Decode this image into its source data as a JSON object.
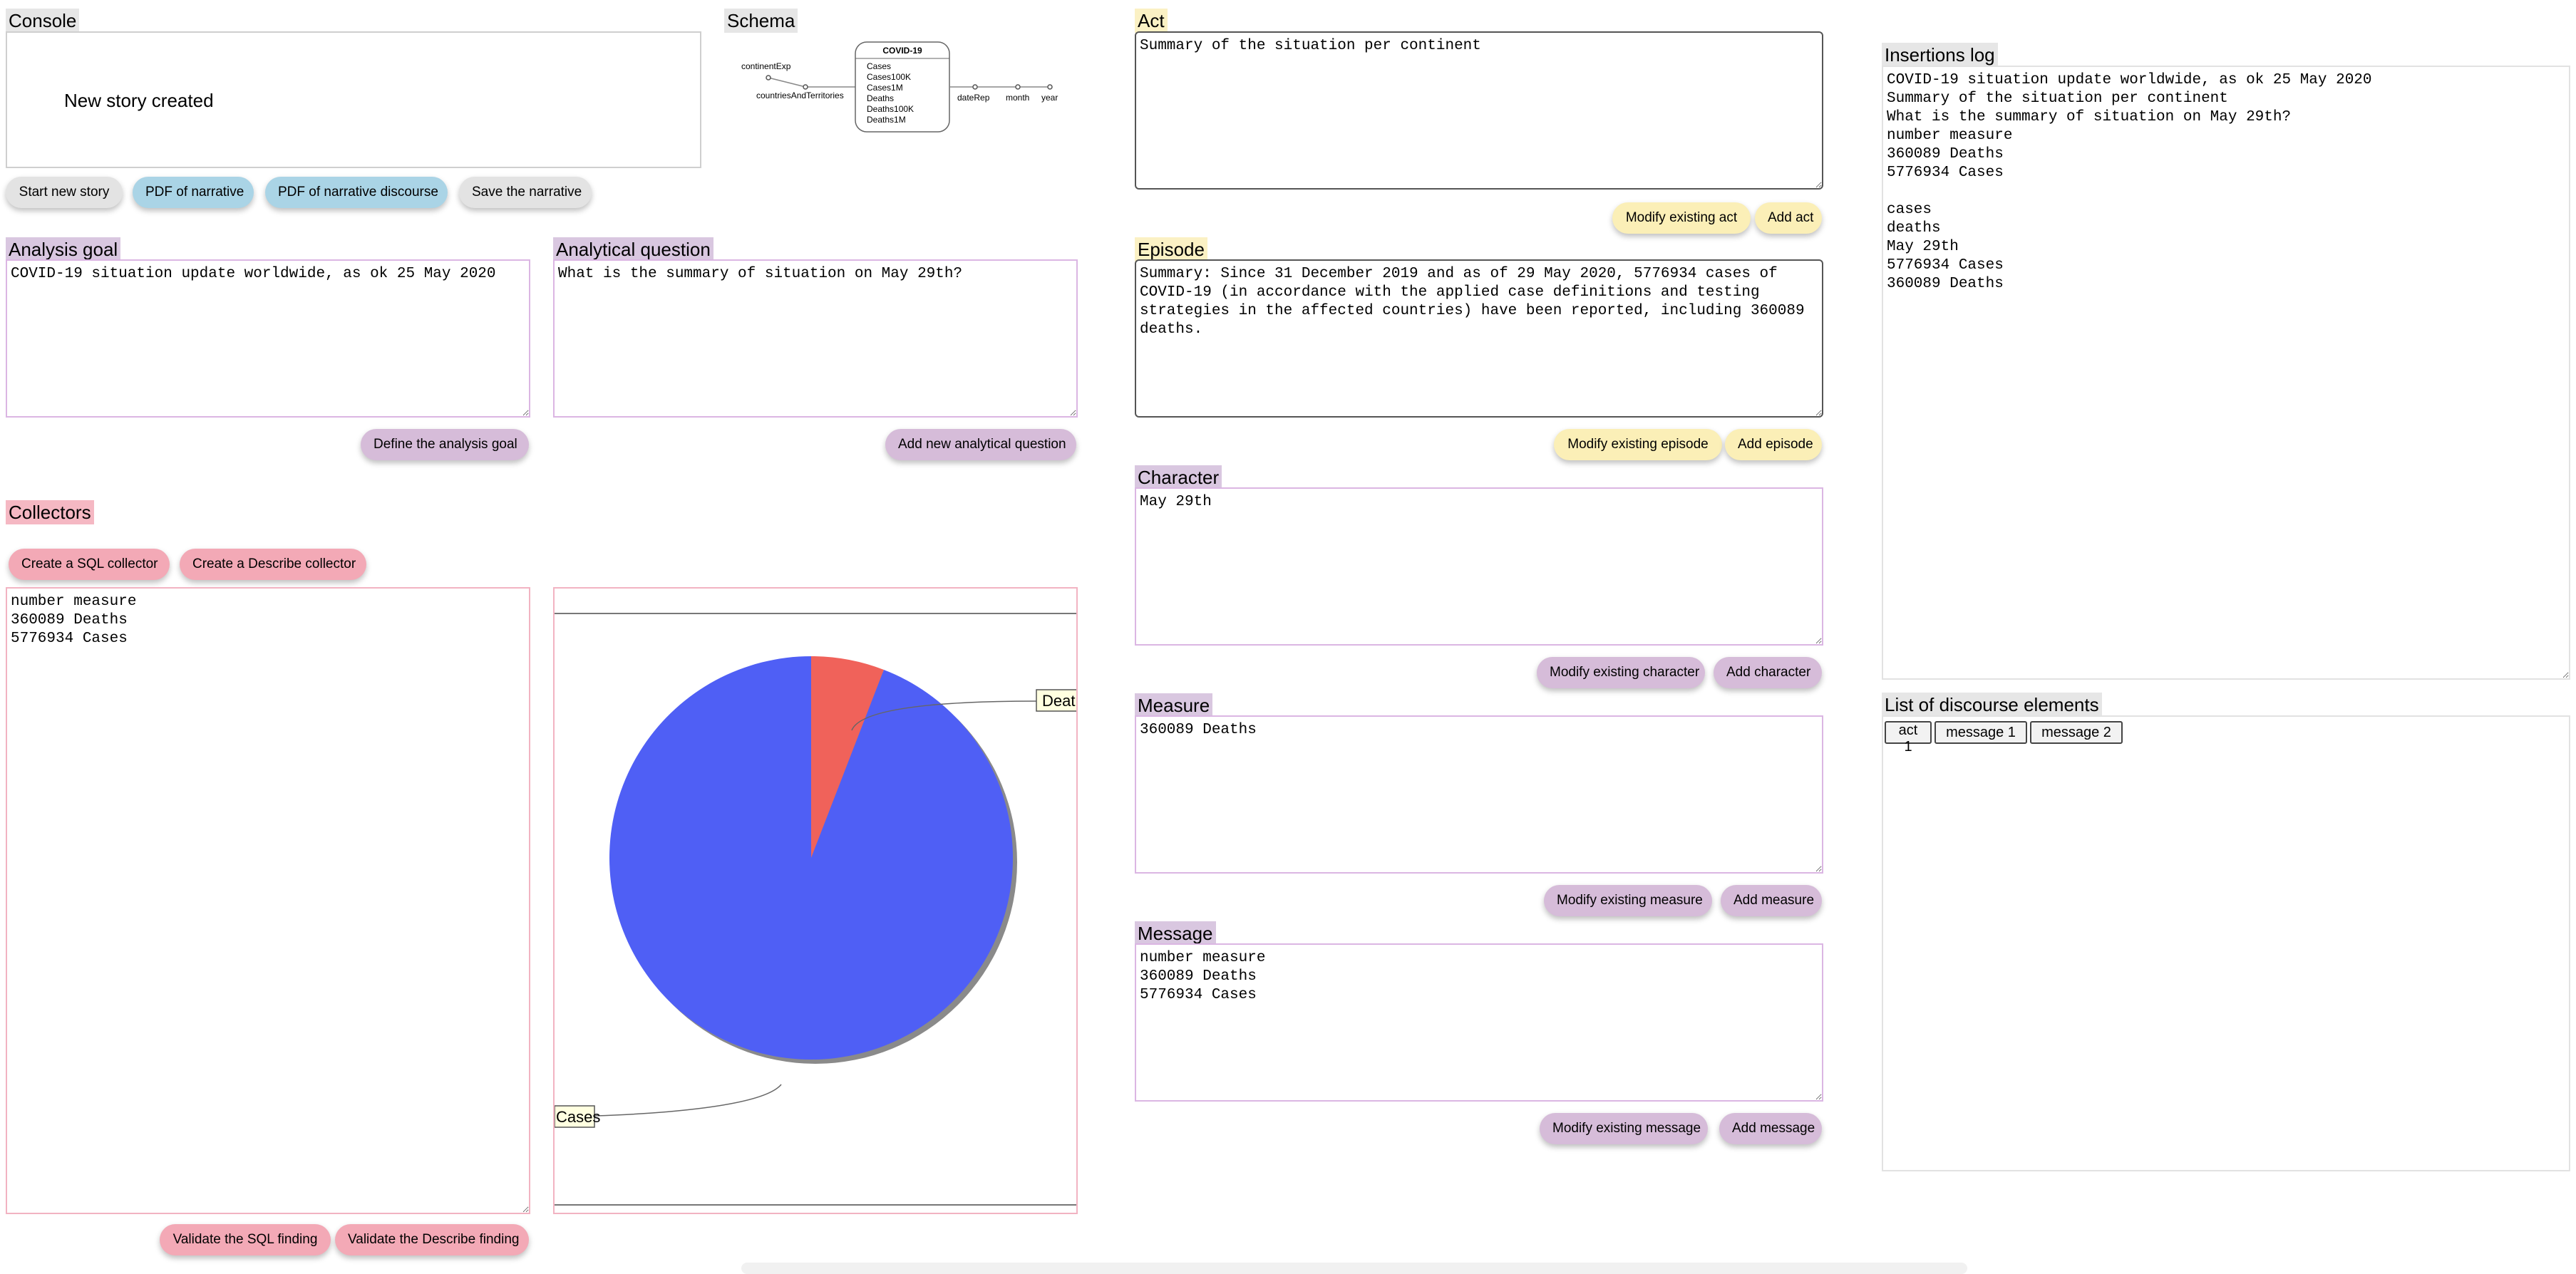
{
  "console": {
    "title": "Console",
    "message": "New story created"
  },
  "story_buttons": {
    "start": "Start new story",
    "pdf_narrative": "PDF of narrative",
    "pdf_discourse": "PDF of narrative discourse",
    "save": "Save the narrative"
  },
  "schema": {
    "title": "Schema",
    "entity": "COVID-19",
    "measures": [
      "Cases",
      "Cases100K",
      "Cases1M",
      "Deaths",
      "Deaths100K",
      "Deaths1M"
    ],
    "left_labels": [
      "continentExp",
      "countriesAndTerritories"
    ],
    "right_labels": [
      "dateRep",
      "month",
      "year"
    ]
  },
  "analysis_goal": {
    "title": "Analysis goal",
    "value": "COVID-19 situation update worldwide, as ok 25 May 2020",
    "button": "Define the analysis goal"
  },
  "analytical_question": {
    "title": "Analytical question",
    "value": "What is the summary of situation on May 29th?",
    "button": "Add new analytical question"
  },
  "collectors": {
    "title": "Collectors",
    "sql_button": "Create a SQL collector",
    "describe_button": "Create a Describe collector",
    "result_text": "number measure\n360089 Deaths\n5776934 Cases",
    "validate_sql": "Validate the SQL finding",
    "validate_describe": "Validate the Describe finding"
  },
  "chart_data": {
    "type": "pie",
    "categories": [
      "Deaths",
      "Cases"
    ],
    "values": [
      360089,
      5776934
    ],
    "colors": [
      "#f0625a",
      "#4f5ff5"
    ],
    "label_texts": [
      "Deatl",
      "Cases"
    ],
    "title": ""
  },
  "act": {
    "title": "Act",
    "value": "Summary of the situation per continent",
    "modify": "Modify existing act",
    "add": "Add act"
  },
  "episode": {
    "title": "Episode",
    "value": "Summary: Since 31 December 2019 and as of 29 May 2020, 5776934 cases of\nCOVID-19 (in accordance with the applied case definitions and testing\nstrategies in the affected countries) have been reported, including 360089\ndeaths.",
    "modify": "Modify existing episode",
    "add": "Add episode"
  },
  "character": {
    "title": "Character",
    "value": "May 29th",
    "modify": "Modify existing character",
    "add": "Add character"
  },
  "measure": {
    "title": "Measure",
    "value": "360089 Deaths",
    "modify": "Modify existing measure",
    "add": "Add measure"
  },
  "message": {
    "title": "Message",
    "value": "number measure\n360089 Deaths\n5776934 Cases",
    "modify": "Modify existing message",
    "add": "Add message"
  },
  "insertions_log": {
    "title": "Insertions log",
    "text": "COVID-19 situation update worldwide, as ok 25 May 2020\nSummary of the situation per continent\nWhat is the summary of situation on May 29th?\nnumber measure\n360089 Deaths\n5776934 Cases\n\ncases\ndeaths\nMay 29th\n5776934 Cases\n360089 Deaths"
  },
  "discourse": {
    "title": "List of discourse elements",
    "items": [
      "act 1",
      "message 1",
      "message 2"
    ]
  }
}
